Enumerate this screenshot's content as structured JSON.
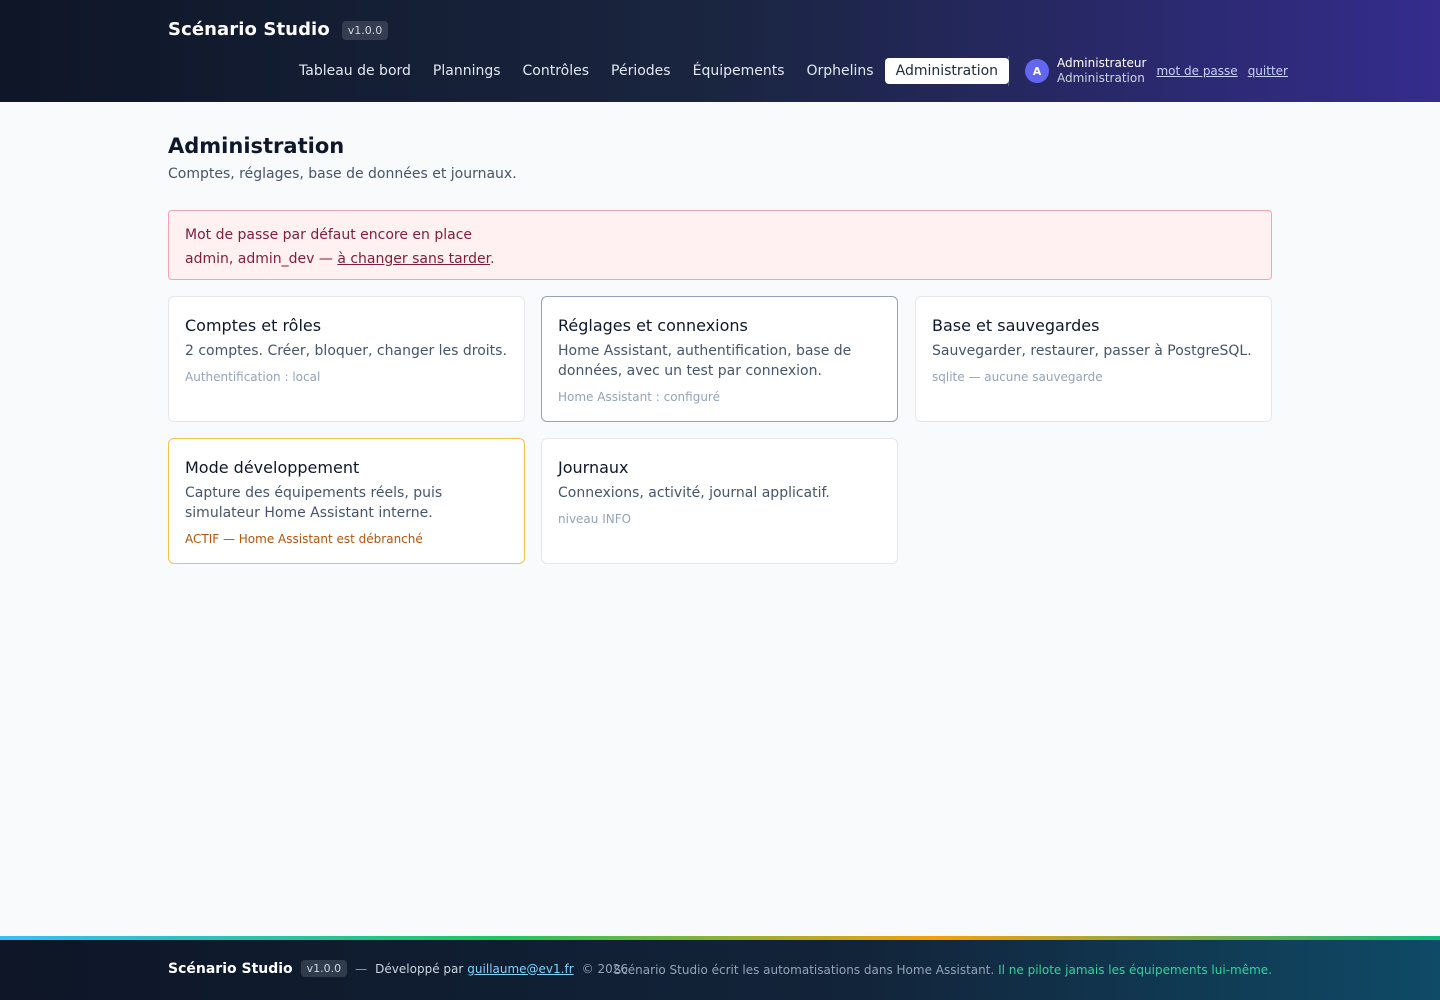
{
  "header": {
    "brand": "Scénario Studio",
    "version": "v1.0.0",
    "nav": [
      {
        "label": "Tableau de bord",
        "active": false
      },
      {
        "label": "Plannings",
        "active": false
      },
      {
        "label": "Contrôles",
        "active": false
      },
      {
        "label": "Périodes",
        "active": false
      },
      {
        "label": "Équipements",
        "active": false
      },
      {
        "label": "Orphelins",
        "active": false
      },
      {
        "label": "Administration",
        "active": true
      }
    ],
    "user": {
      "initial": "A",
      "name": "Administrateur",
      "role": "Administration",
      "password_link": "mot de passe",
      "logout_link": "quitter"
    }
  },
  "main": {
    "title": "Administration",
    "subtitle": "Comptes, réglages, base de données et journaux.",
    "alert": {
      "title": "Mot de passe par défaut encore en place",
      "accounts": "admin, admin_dev — ",
      "link": "à changer sans tarder",
      "end": "."
    },
    "cards": [
      {
        "title": "Comptes et rôles",
        "desc": "2 comptes. Créer, bloquer, changer les droits.",
        "meta": "Authentification : local"
      },
      {
        "title": "Réglages et connexions",
        "desc": "Home Assistant, authentification, base de données, avec un test par connexion.",
        "meta": "Home Assistant : configuré"
      },
      {
        "title": "Base et sauvegardes",
        "desc": "Sauvegarder, restaurer, passer à PostgreSQL.",
        "meta": "sqlite — aucune sauvegarde"
      },
      {
        "title": "Mode développement",
        "desc": "Capture des équipements réels, puis simulateur Home Assistant interne.",
        "meta": "ACTIF — Home Assistant est débranché"
      },
      {
        "title": "Journaux",
        "desc": "Connexions, activité, journal applicatif.",
        "meta": "niveau INFO"
      }
    ]
  },
  "footer": {
    "brand": "Scénario Studio",
    "version": "v1.0.0",
    "dash": "—",
    "dev_prefix": "Développé par",
    "email": "guillaume@ev1.fr",
    "copyright": "© 2026",
    "tagline": "Scénario Studio écrit les automatisations dans Home Assistant.",
    "tagline_accent": "Il ne pilote jamais les équipements lui-même."
  },
  "colors": {
    "accent": "#6366f1",
    "alert_bg": "#fff0f2",
    "warn_border": "#f2c14e",
    "warn_text": "#b45309",
    "footer_accent": "#34d399"
  }
}
